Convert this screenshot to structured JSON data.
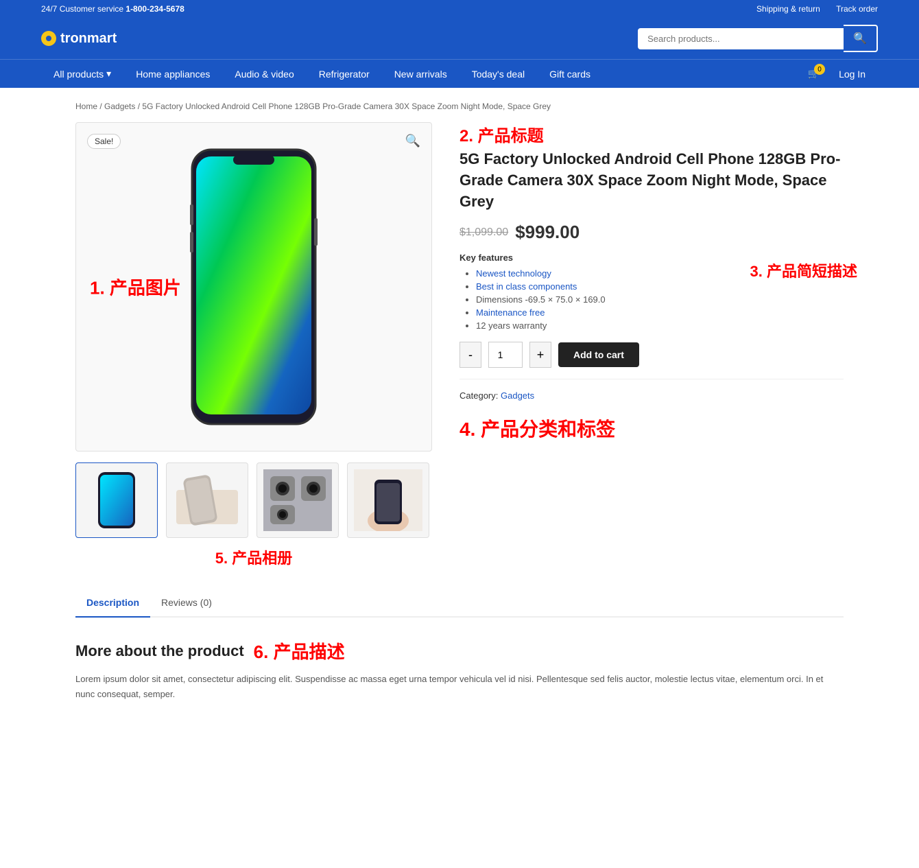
{
  "topbar": {
    "customer_service": "24/7 Customer service",
    "phone": "1-800-234-5678",
    "links": [
      {
        "label": "Shipping & return",
        "id": "shipping-return"
      },
      {
        "label": "Track order",
        "id": "track-order"
      }
    ]
  },
  "header": {
    "logo_text": "tronmart",
    "search_placeholder": "Search products..."
  },
  "nav": {
    "items": [
      {
        "label": "All products",
        "has_arrow": true
      },
      {
        "label": "Home appliances"
      },
      {
        "label": "Audio & video"
      },
      {
        "label": "Refrigerator"
      },
      {
        "label": "New arrivals"
      },
      {
        "label": "Today's deal"
      },
      {
        "label": "Gift cards"
      }
    ],
    "cart_count": "0",
    "login_label": "Log In"
  },
  "breadcrumb": {
    "items": [
      {
        "label": "Home",
        "href": "#"
      },
      {
        "label": "Gadgets",
        "href": "#"
      },
      {
        "label": "5G Factory Unlocked Android Cell Phone 128GB Pro-Grade Camera 30X Space Zoom Night Mode, Space Grey",
        "href": "#"
      }
    ]
  },
  "product": {
    "sale_badge": "Sale!",
    "title": "5G Factory Unlocked Android Cell Phone 128GB Pro-Grade Camera 30X Space Zoom Night Mode, Space Grey",
    "old_price": "$1,099.00",
    "new_price": "$999.00",
    "key_features_label": "Key features",
    "features": [
      "Newest technology",
      "Best in class components",
      "Dimensions -69.5 × 75.0 × 169.0",
      "Maintenance free",
      "12 years warranty"
    ],
    "quantity": "1",
    "add_to_cart": "Add to cart",
    "category_label": "Category:",
    "category_value": "Gadgets"
  },
  "annotations": {
    "ann1": "1. 产品图片",
    "ann2": "2. 产品标题",
    "ann3": "3. 产品简短描述",
    "ann4": "4. 产品分类和标签",
    "ann5": "5. 产品相册",
    "ann6": "6. 产品描述"
  },
  "tabs": [
    {
      "label": "Description",
      "active": true
    },
    {
      "label": "Reviews (0)",
      "active": false
    }
  ],
  "description": {
    "title": "More about the product",
    "text": "Lorem ipsum dolor sit amet, consectetur adipiscing elit. Suspendisse ac massa eget urna tempor vehicula vel id nisi. Pellentesque sed felis auctor, molestie lectus vitae, elementum orci. In et nunc consequat, semper."
  }
}
